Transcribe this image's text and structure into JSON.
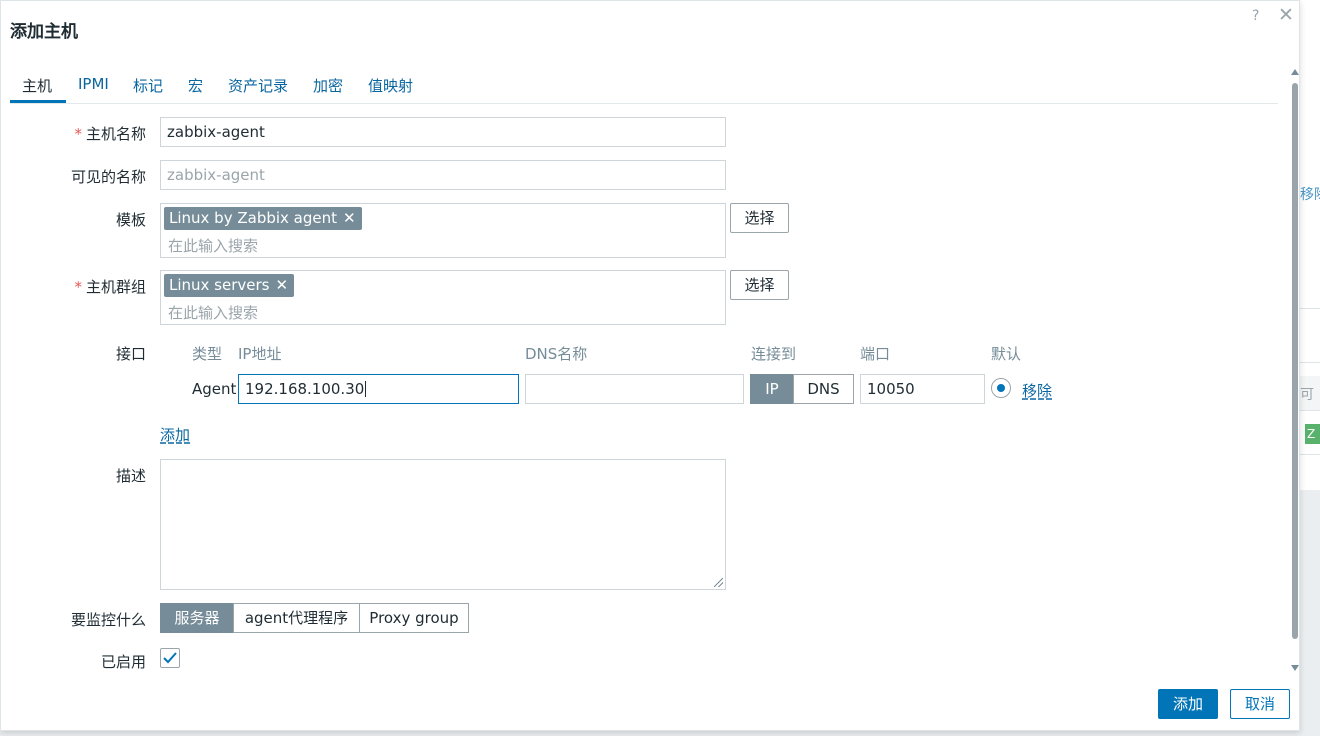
{
  "background": {
    "remove_link": "移除",
    "col_text": "可",
    "badge": "Z"
  },
  "dialog": {
    "title": "添加主机",
    "help_icon": "?",
    "close_icon": "✕"
  },
  "tabs": [
    {
      "label": "主机",
      "active": true
    },
    {
      "label": "IPMI"
    },
    {
      "label": "标记"
    },
    {
      "label": "宏"
    },
    {
      "label": "资产记录"
    },
    {
      "label": "加密"
    },
    {
      "label": "值映射"
    }
  ],
  "form": {
    "host_name": {
      "label": "主机名称",
      "value": "zabbix-agent"
    },
    "visible_name": {
      "label": "可见的名称",
      "placeholder": "zabbix-agent"
    },
    "templates": {
      "label": "模板",
      "chips": [
        "Linux by Zabbix agent"
      ],
      "placeholder": "在此输入搜索",
      "select_button": "选择"
    },
    "host_groups": {
      "label": "主机群组",
      "chips": [
        "Linux servers"
      ],
      "placeholder": "在此输入搜索",
      "select_button": "选择"
    },
    "interfaces": {
      "label": "接口",
      "headers": {
        "type": "类型",
        "ip": "IP地址",
        "dns": "DNS名称",
        "connect": "连接到",
        "port": "端口",
        "default": "默认"
      },
      "rows": [
        {
          "type": "Agent",
          "ip": "192.168.100.30",
          "dns": "",
          "connect_options": [
            "IP",
            "DNS"
          ],
          "connect_selected": "IP",
          "port": "10050",
          "remove": "移除"
        }
      ],
      "add_link": "添加"
    },
    "description": {
      "label": "描述",
      "value": ""
    },
    "monitored_by": {
      "label": "要监控什么",
      "options": [
        "服务器",
        "agent代理程序",
        "Proxy group"
      ],
      "selected": "服务器"
    },
    "enabled": {
      "label": "已启用",
      "checked": true
    }
  },
  "footer": {
    "add_button": "添加",
    "cancel_button": "取消"
  },
  "colors": {
    "primary": "#0275b8",
    "chip": "#768d99",
    "required": "#e45959",
    "link": "#0a66a0"
  }
}
